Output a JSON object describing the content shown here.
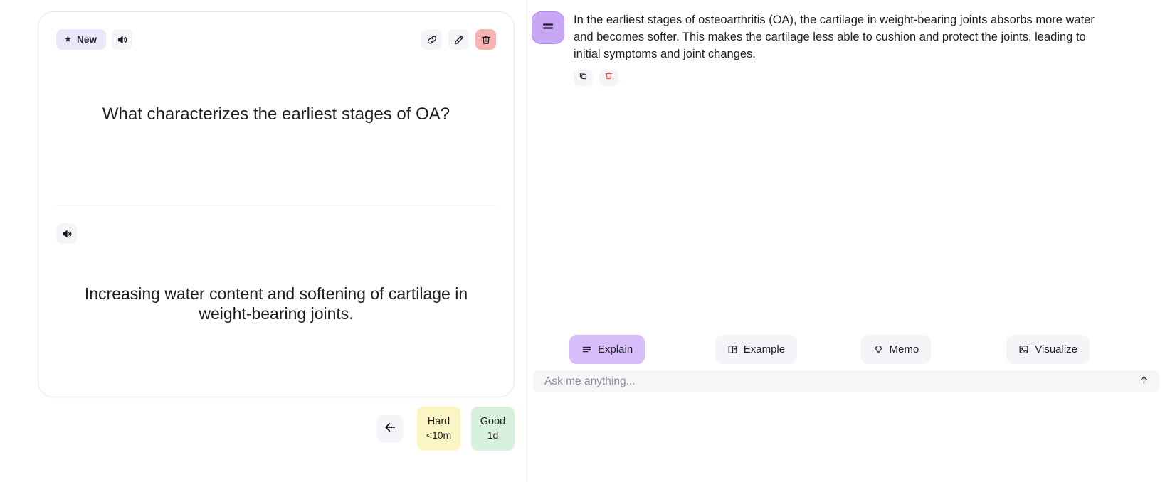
{
  "flashcard": {
    "badge": {
      "label": "New",
      "icon": "sparkle-icon"
    },
    "toolbar": {
      "audio_icon": "speaker-icon",
      "link_icon": "link-icon",
      "edit_icon": "pencil-icon",
      "delete_icon": "trash-icon"
    },
    "question": "What characterizes the earliest stages of OA?",
    "answer_audio_icon": "speaker-icon",
    "answer": "Increasing water content and softening of cartilage in weight-bearing joints.",
    "review": {
      "back_icon": "arrow-left-icon",
      "buttons": [
        {
          "label": "Hard",
          "interval": "<10m",
          "color": "#fbf4c3"
        },
        {
          "label": "Good",
          "interval": "1d",
          "color": "#d8f1dd"
        }
      ]
    }
  },
  "chat": {
    "avatar_icon": "text-lines-icon",
    "avatar_color": "#c8a8f5",
    "message": "In the earliest stages of osteoarthritis (OA), the cartilage in weight-bearing joints absorbs more water and becomes softer. This makes the cartilage less able to cushion and protect the joints, leading to initial symptoms and joint changes.",
    "message_actions": [
      {
        "name": "copy-button",
        "icon": "copy-icon"
      },
      {
        "name": "delete-message-button",
        "icon": "trash-icon"
      }
    ],
    "quick_actions": [
      {
        "label": "Explain",
        "icon": "lines-icon",
        "active": true
      },
      {
        "label": "Example",
        "icon": "book-icon",
        "active": false
      },
      {
        "label": "Memo",
        "icon": "lightbulb-icon",
        "active": false
      },
      {
        "label": "Visualize",
        "icon": "image-icon",
        "active": false
      }
    ],
    "input": {
      "value": "",
      "placeholder": "Ask me anything...",
      "send_icon": "arrow-up-icon"
    }
  },
  "colors": {
    "accent_purple": "#d8bdfb",
    "badge_purple": "#ece6fb",
    "danger_red": "#f6b3b3",
    "hard_yellow": "#fbf4c3",
    "good_green": "#d8f1dd"
  }
}
